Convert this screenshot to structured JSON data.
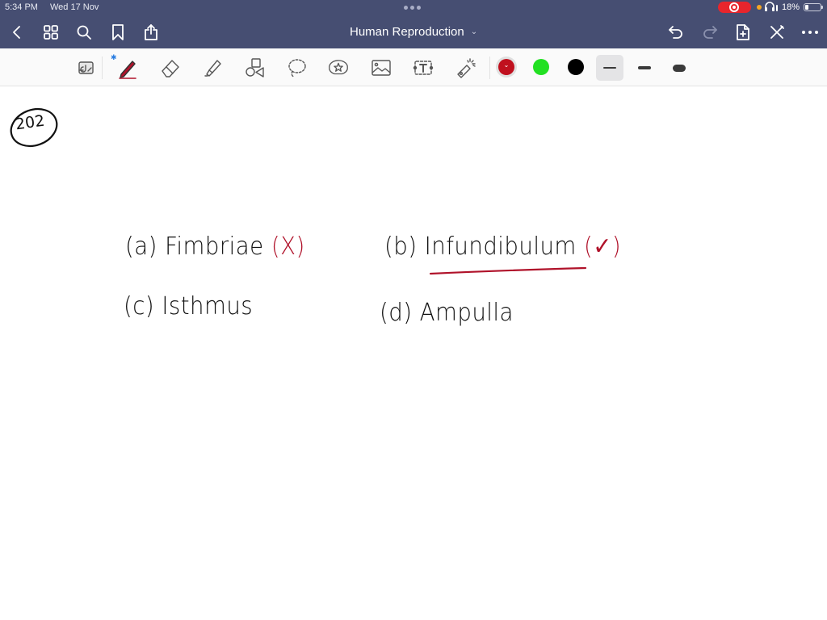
{
  "status_bar": {
    "time": "5:34 PM",
    "date": "Wed 17 Nov",
    "battery_percent": "18%",
    "recording": true,
    "headphones_icon": "headphones-icon",
    "colors": {
      "background": "#464e72",
      "recording": "#e8252c",
      "mic_indicator": "#f5a623"
    }
  },
  "nav_bar": {
    "title": "Human Reproduction",
    "left_icons": [
      "back-icon",
      "grid-icon",
      "search-icon",
      "bookmark-icon",
      "share-icon"
    ],
    "right_icons": [
      "undo-icon",
      "redo-icon",
      "add-page-icon",
      "close-edit-icon",
      "more-icon"
    ]
  },
  "toolbar": {
    "tools": [
      "read-only-toggle",
      "pen",
      "eraser",
      "highlighter",
      "shapes",
      "lasso",
      "elements",
      "image",
      "text",
      "laser-pointer"
    ],
    "selected_tool": "pen",
    "pen_bluetooth_indicator": "✱",
    "colors": [
      {
        "name": "red",
        "hex": "#c0101e",
        "selected": true
      },
      {
        "name": "green",
        "hex": "#22e022",
        "selected": false
      },
      {
        "name": "black",
        "hex": "#000000",
        "selected": false
      }
    ],
    "thicknesses": [
      {
        "name": "thin",
        "selected": true
      },
      {
        "name": "medium",
        "selected": false
      },
      {
        "name": "thick",
        "selected": false
      }
    ]
  },
  "page": {
    "question_number": "202",
    "options": [
      {
        "label": "(a)",
        "text": "Fimbriae",
        "mark": "(X)",
        "mark_type": "wrong"
      },
      {
        "label": "(b)",
        "text": "Infundibulum",
        "mark": "(✓)",
        "mark_type": "correct",
        "underlined": true
      },
      {
        "label": "(c)",
        "text": "Isthmus"
      },
      {
        "label": "(d)",
        "text": "Ampulla"
      }
    ],
    "ink_colors": {
      "black": "#111111",
      "red": "#b0122a"
    }
  }
}
